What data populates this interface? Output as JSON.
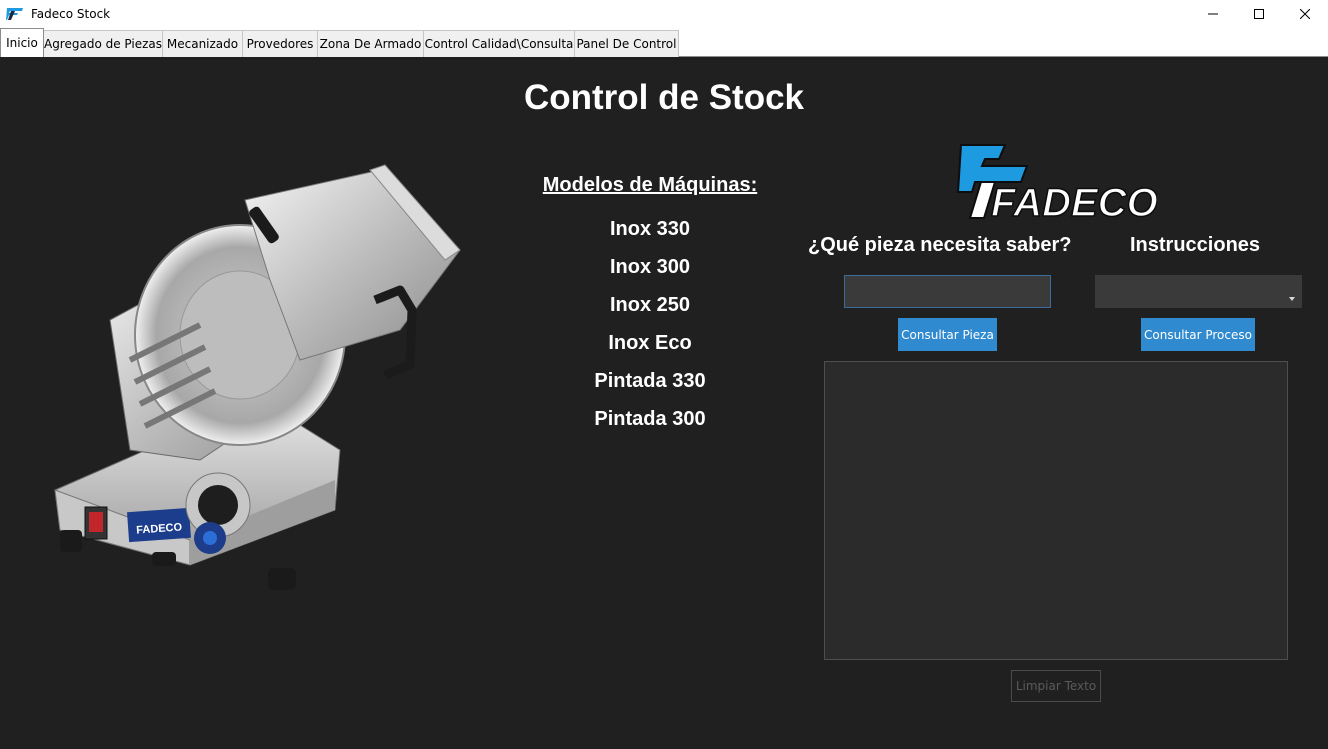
{
  "window": {
    "title": "Fadeco Stock"
  },
  "tabs": [
    {
      "label": "Inicio"
    },
    {
      "label": "Agregado de Piezas"
    },
    {
      "label": "Mecanizado"
    },
    {
      "label": "Provedores"
    },
    {
      "label": "Zona De Armado"
    },
    {
      "label": "Control Calidad\\Consulta"
    },
    {
      "label": "Panel De Control"
    }
  ],
  "main": {
    "heading": "Control de Stock",
    "models_title": "Modelos de Máquinas:",
    "models": [
      "Inox 330",
      "Inox 300",
      "Inox 250",
      "Inox Eco",
      "Pintada 330",
      "Pintada 300"
    ],
    "logo_text": "FADECO",
    "question_label": "¿Qué pieza necesita saber?",
    "instructions_label": "Instrucciones",
    "pieza_input_value": "",
    "instructions_selected": "",
    "consult_piece_button": "Consultar Pieza",
    "consult_process_button": "Consultar Proceso",
    "output_text": "",
    "clear_button": "Limpiar Texto",
    "machine_badge": "FADECO"
  },
  "colors": {
    "background": "#202020",
    "accent_blue": "#2f8ad0",
    "logo_blue": "#1e9be0"
  }
}
